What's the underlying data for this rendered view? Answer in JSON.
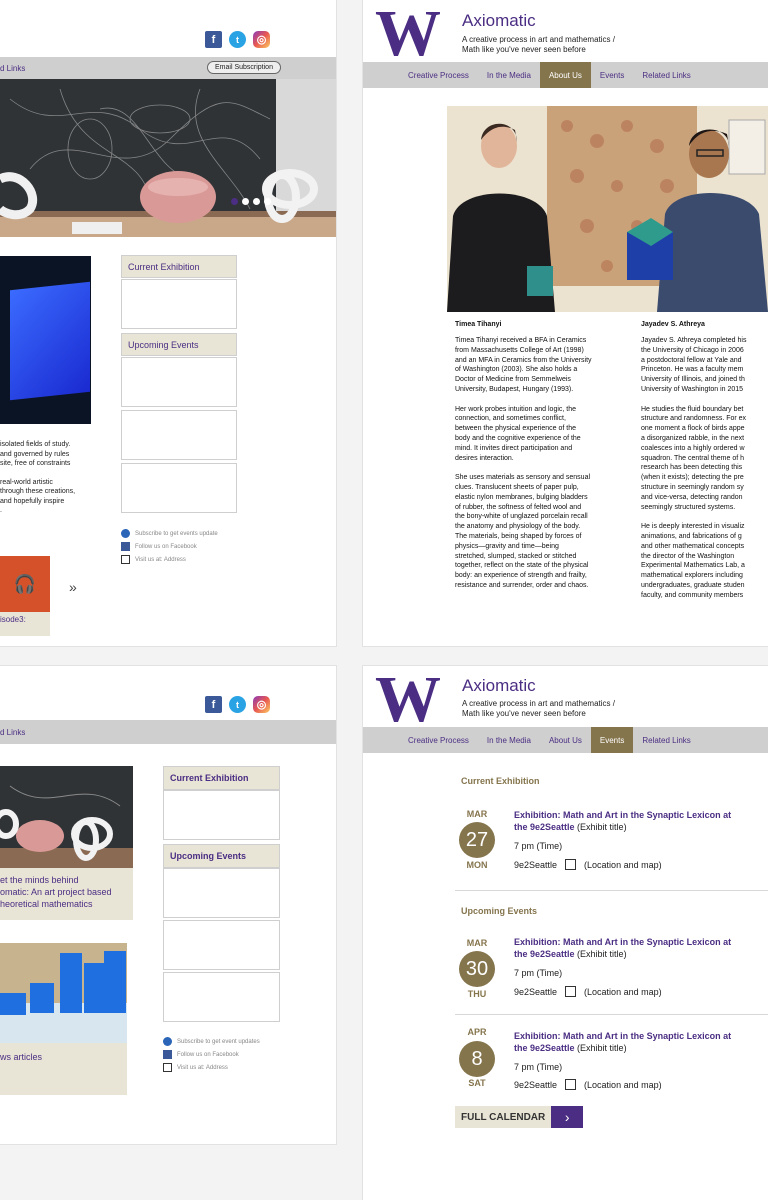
{
  "top_left": {
    "nav_fragment": "d Links",
    "email_button": "Email Subscription",
    "side": {
      "current": "Current Exhibition",
      "upcoming": "Upcoming Events"
    },
    "notes": [
      "Subscribe to get events update",
      "Follow us on Facebook",
      "Visit us at: Address"
    ],
    "body_lines": [
      "isolated fields of study.",
      "and governed by rules",
      "site, free of constraints",
      "",
      "real-world artistic",
      "through these creations,",
      "and hopefully inspire",
      "."
    ],
    "podcast_caption": "isode3:",
    "more_arrow": "»"
  },
  "bottom_left": {
    "nav_fragment": "d Links",
    "side": {
      "current": "Current Exhibition",
      "upcoming": "Upcoming Events"
    },
    "notes": [
      "Subscribe to get event updates",
      "Follow us on Facebook",
      "Visit us at: Address"
    ],
    "card1_caption": "et the minds behind\nomatic: An art project based\nheoretical mathematics",
    "card2_caption": "ws articles"
  },
  "header": {
    "logo": "W",
    "title": "Axiomatic",
    "tagline": "A creative process in art and mathematics /\nMath like you've never seen before",
    "nav": [
      "Creative Process",
      "In the Media",
      "About Us",
      "Events",
      "Related Links"
    ]
  },
  "about": {
    "active_tab": "About Us",
    "people": [
      {
        "name": "Timea Tihanyi",
        "bio": "Timea Tihanyi received a BFA in Ceramics\nfrom Massachusetts College of Art (1998)\nand an MFA in Ceramics from the University\nof Washington (2003). She also holds a\nDoctor of Medicine from Semmelweis\nUniversity, Budapest, Hungary (1993).\n\nHer work probes intuition and logic, the\nconnection, and sometimes conflict,\nbetween the physical experience of the\nbody and the cognitive experience of the\nmind. It invites direct participation and\ndesires interaction.\n\nShe uses materials as sensory and sensual\nclues. Translucent sheets of paper pulp,\nelastic nylon membranes, bulging bladders\nof rubber, the softness of felted wool and\nthe bony-white of unglazed porcelain recall\nthe anatomy and physiology of the body.\nThe materials, being shaped by forces of\nphysics—gravity and time—being\nstretched, slumped, stacked or stitched\ntogether, reflect on the state of the physical\nbody: an experience of strength and frailty,\nresistance and surrender, order and chaos."
      },
      {
        "name": "Jayadev S. Athreya",
        "bio": "Jayadev S. Athreya completed his\nthe University of Chicago in 2006\na postdoctoral fellow at Yale and\nPrinceton. He was a faculty mem\nUniversity of Illinois, and joined th\nUniversity of Washington in 2015\n\nHe studies the fluid boundary bet\nstructure and randomness. For ex\none moment a flock of birds appe\na disorganized rabble, in the next\ncoalesces into a highly ordered w\nsquadron. The central theme of h\nresearch has been detecting this\n(when it exists); detecting the pre\nstructure in seemingly random sy\nand vice-versa, detecting randon\nseemingly structured systems.\n\nHe is deeply interested in visualiz\nanimations, and fabrications of g\nand other mathematical concepts\nthe director of the Washington\nExperimental Mathematics Lab, a\nmathematical explorers including\nundergraduates, graduate studen\nfaculty, and community members"
      }
    ]
  },
  "events": {
    "active_tab": "Events",
    "current_label": "Current Exhibition",
    "upcoming_label": "Upcoming Events",
    "items": [
      {
        "month": "MAR",
        "day": "27",
        "weekday": "MON",
        "title": "Exhibition: Math and Art in the Synaptic Lexicon at the 9e2Seattle",
        "kind": "(Exhibit title)",
        "time": "7 pm (Time)",
        "venue": "9e2Seattle",
        "location": "(Location and map)"
      },
      {
        "month": "MAR",
        "day": "30",
        "weekday": "THU",
        "title": "Exhibition: Math and Art in the Synaptic Lexicon at the 9e2Seattle",
        "kind": "(Exhibit title)",
        "time": "7 pm (Time)",
        "venue": "9e2Seattle",
        "location": "(Location and map)"
      },
      {
        "month": "APR",
        "day": "8",
        "weekday": "SAT",
        "title": "Exhibition: Math and Art in the Synaptic Lexicon at the 9e2Seattle",
        "kind": "(Exhibit title)",
        "time": "7 pm (Time)",
        "venue": "9e2Seattle",
        "location": "(Location and map)"
      }
    ],
    "full_calendar": "FULL CALENDAR",
    "full_calendar_arrow": "›"
  },
  "colors": {
    "uw_purple": "#4b2e83",
    "uw_gold": "#85754d",
    "nav_gray": "#cfcfcf"
  }
}
